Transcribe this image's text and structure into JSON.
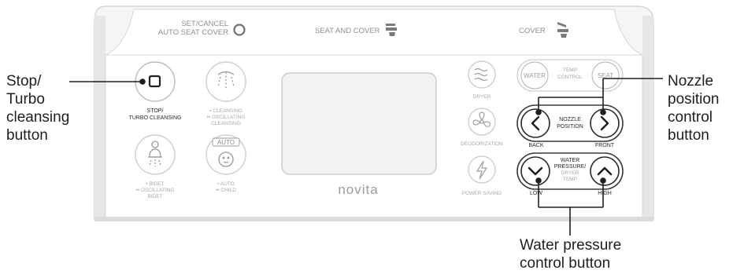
{
  "panel": {
    "top_labels": {
      "set_cancel_line1": "SET/CANCEL",
      "set_cancel_line2": "AUTO SEAT COVER",
      "seat_and_cover": "SEAT AND COVER",
      "cover": "COVER"
    },
    "brand": "novita",
    "left_buttons": {
      "stop_label_1": "STOP/",
      "stop_label_2": "TURBO CLEANSING",
      "cleansing_1": "• CLEANSING",
      "cleansing_2": "•• OSCILLATING",
      "cleansing_3": "CLEANSING",
      "bidet_1": "• BIDET",
      "bidet_2": "•• OSCILLATING",
      "bidet_3": "BIDET",
      "auto_1": "• AUTO",
      "auto_2": "•• CHILD",
      "auto_badge": "AUTO"
    },
    "middle_buttons": {
      "dryer": "DRYER",
      "deodorization": "DEODORIZATION",
      "power_saving": "POWER SAVING"
    },
    "right_controls": {
      "water": "WATER",
      "temp_1": "TEMP",
      "temp_2": "CONTROL",
      "seat": "SEAT",
      "nozzle_1": "NOZZLE",
      "nozzle_2": "POSITION",
      "back": "BACK",
      "front": "FRONT",
      "pressure_1": "WATER",
      "pressure_2": "PRESSURE/",
      "pressure_3": "DRYER",
      "pressure_4": "TEMP",
      "low": "LOW",
      "high": "HIGH"
    }
  },
  "callouts": {
    "stop_turbo": "Stop/\nTurbo\ncleansing\nbutton",
    "nozzle": "Nozzle\nposition\ncontrol\nbutton",
    "water_pressure": "Water pressure\ncontrol button"
  }
}
